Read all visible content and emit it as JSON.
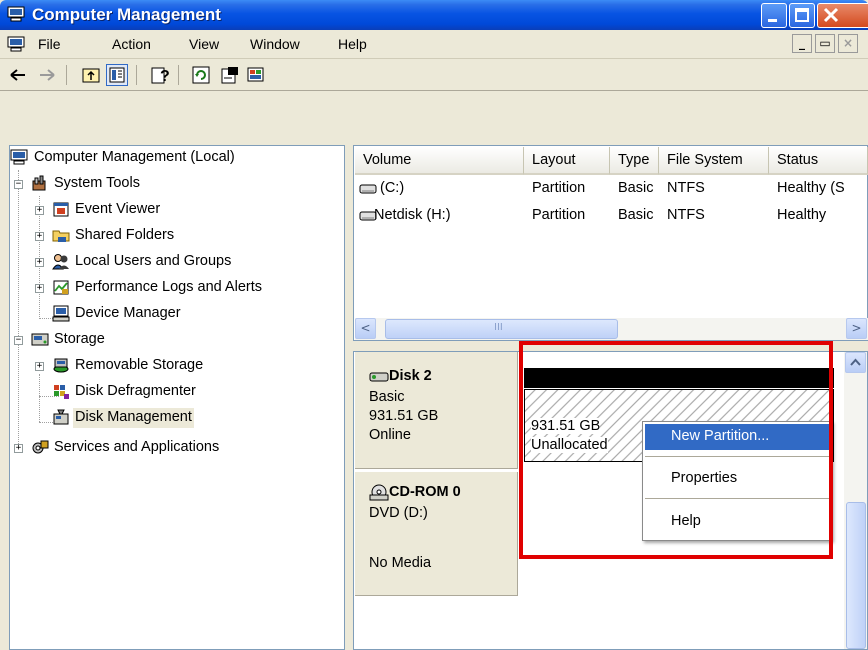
{
  "window": {
    "title": "Computer Management",
    "colors": {
      "titlebar": "#0854e3",
      "highlight": "#316ac5",
      "annotation": "#e00000"
    }
  },
  "menubar": {
    "items": [
      "File",
      "Action",
      "View",
      "Window",
      "Help"
    ]
  },
  "toolbar": {
    "icons": [
      "back-arrow-icon",
      "forward-arrow-icon",
      "up-folder-icon",
      "show-hide-tree-icon",
      "help-icon",
      "refresh-icon",
      "properties-icon",
      "disk-management-icon"
    ]
  },
  "tree": {
    "root": "Computer Management (Local)",
    "system_tools": "System Tools",
    "event_viewer": "Event Viewer",
    "shared_folders": "Shared Folders",
    "local_users": "Local Users and Groups",
    "perf_logs": "Performance Logs and Alerts",
    "device_manager": "Device Manager",
    "storage": "Storage",
    "removable_storage": "Removable Storage",
    "disk_defragmenter": "Disk Defragmenter",
    "disk_management": "Disk Management",
    "services_apps": "Services and Applications",
    "expanders": {
      "expanded": "−",
      "collapsed": "+"
    }
  },
  "volume_list": {
    "columns": [
      "Volume",
      "Layout",
      "Type",
      "File System",
      "Status"
    ],
    "rows": [
      {
        "volume": "(C:)",
        "layout": "Partition",
        "type": "Basic",
        "fs": "NTFS",
        "status": "Healthy (S"
      },
      {
        "volume": "Netdisk (H:)",
        "layout": "Partition",
        "type": "Basic",
        "fs": "NTFS",
        "status": "Healthy"
      }
    ],
    "scroll_left": "<",
    "scroll_right": ">",
    "thumb_grip": "III"
  },
  "disks": [
    {
      "name": "Disk 2",
      "type": "Basic",
      "size": "931.51 GB",
      "status": "Online"
    },
    {
      "name": "CD-ROM 0",
      "type": "DVD (D:)",
      "size": "",
      "status": "No Media"
    }
  ],
  "unallocated": {
    "size": "931.51 GB",
    "label": "Unallocated"
  },
  "context_menu": {
    "items": [
      "New Partition...",
      "Properties",
      "Help"
    ]
  }
}
